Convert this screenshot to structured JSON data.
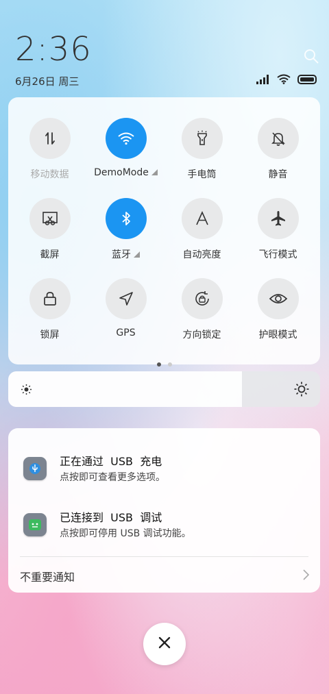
{
  "status": {
    "time": "2:36",
    "date": "6月26日 周三"
  },
  "quick_settings": {
    "tiles": [
      {
        "label": "移动数据",
        "icon": "mobile-data-icon",
        "active": false,
        "dim": true
      },
      {
        "label": "DemoMode",
        "icon": "wifi-icon",
        "active": true,
        "expand": true
      },
      {
        "label": "手电筒",
        "icon": "flashlight-icon",
        "active": false
      },
      {
        "label": "静音",
        "icon": "bell-off-icon",
        "active": false
      },
      {
        "label": "截屏",
        "icon": "screenshot-icon",
        "active": false
      },
      {
        "label": "蓝牙",
        "icon": "bluetooth-icon",
        "active": true,
        "expand": true
      },
      {
        "label": "自动亮度",
        "icon": "auto-brightness-icon",
        "active": false
      },
      {
        "label": "飞行模式",
        "icon": "airplane-icon",
        "active": false
      },
      {
        "label": "锁屏",
        "icon": "lock-icon",
        "active": false
      },
      {
        "label": "GPS",
        "icon": "gps-icon",
        "active": false
      },
      {
        "label": "方向锁定",
        "icon": "rotation-lock-icon",
        "active": false
      },
      {
        "label": "护眼模式",
        "icon": "eye-icon",
        "active": false
      }
    ],
    "page_count": 2,
    "current_page": 1,
    "accent_color": "#1b95f2"
  },
  "brightness": {
    "level": 0.75
  },
  "notifications": [
    {
      "title": "正在通过  USB  充电",
      "desc": "点按即可查看更多选项。",
      "icon": "usb-icon"
    },
    {
      "title": "已连接到  USB  调试",
      "desc": "点按即可停用 USB 调试功能。",
      "icon": "android-debug-icon"
    }
  ],
  "unimportant_label": "不重要通知"
}
